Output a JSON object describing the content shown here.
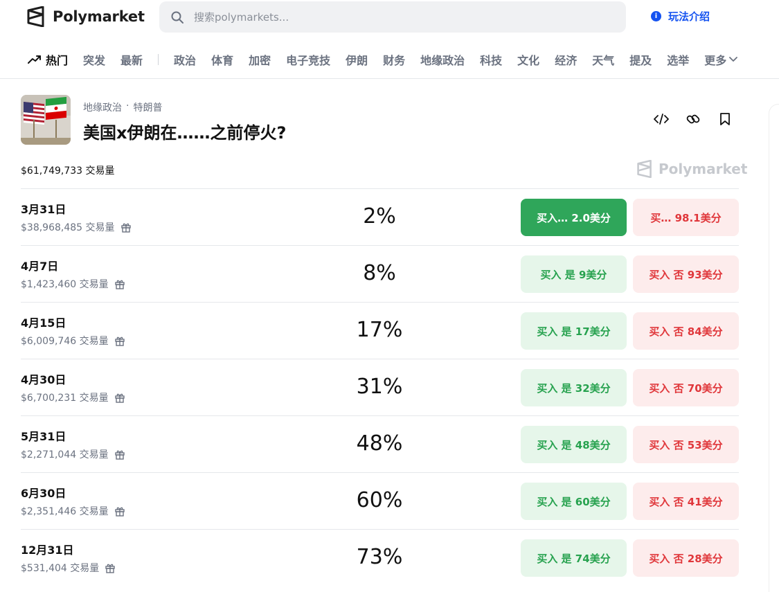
{
  "brand": {
    "name": "Polymarket"
  },
  "search": {
    "placeholder": "搜索polymarkets..."
  },
  "header": {
    "howto_label": "玩法介绍"
  },
  "nav": {
    "trending": "热门",
    "items": [
      "突发",
      "最新",
      "政治",
      "体育",
      "加密",
      "电子竞技",
      "伊朗",
      "财务",
      "地缘政治",
      "科技",
      "文化",
      "经济",
      "天气",
      "提及",
      "选举"
    ],
    "more": "更多"
  },
  "market": {
    "category": "地缘政治",
    "separator": "·",
    "tag": "特朗普",
    "title": "美国x伊朗在……之前停火?",
    "total_volume": "$61,749,733 交易量",
    "watermark": "Polymarket"
  },
  "outcomes": [
    {
      "date": "3月31日",
      "volume": "$38,968,485 交易量",
      "chance": "2%",
      "yes": "买入… 2.0美分",
      "no": "买… 98.1美分",
      "yes_selected": true
    },
    {
      "date": "4月7日",
      "volume": "$1,423,460 交易量",
      "chance": "8%",
      "yes": "买入 是 9美分",
      "no": "买入 否 93美分"
    },
    {
      "date": "4月15日",
      "volume": "$6,009,746 交易量",
      "chance": "17%",
      "yes": "买入 是 17美分",
      "no": "买入 否 84美分"
    },
    {
      "date": "4月30日",
      "volume": "$6,700,231 交易量",
      "chance": "31%",
      "yes": "买入 是 32美分",
      "no": "买入 否 70美分"
    },
    {
      "date": "5月31日",
      "volume": "$2,271,044 交易量",
      "chance": "48%",
      "yes": "买入 是 48美分",
      "no": "买入 否 53美分"
    },
    {
      "date": "6月30日",
      "volume": "$2,351,446 交易量",
      "chance": "60%",
      "yes": "买入 是 60美分",
      "no": "买入 否 41美分"
    },
    {
      "date": "12月31日",
      "volume": "$531,404 交易量",
      "chance": "73%",
      "yes": "买入 是 74美分",
      "no": "买入 否 28美分"
    }
  ],
  "colors": {
    "accent_blue": "#1452f0",
    "yes_green": "#27a24f",
    "yes_bg": "#e6f6ea",
    "yes_solid": "#2fa65a",
    "no_red": "#e0373b",
    "no_bg": "#fdecec"
  },
  "icons": [
    "polymarket-logo-icon",
    "search-icon",
    "info-icon",
    "trending-icon",
    "chevron-down-icon",
    "embed-code-icon",
    "link-icon",
    "bookmark-icon",
    "gift-icon"
  ]
}
